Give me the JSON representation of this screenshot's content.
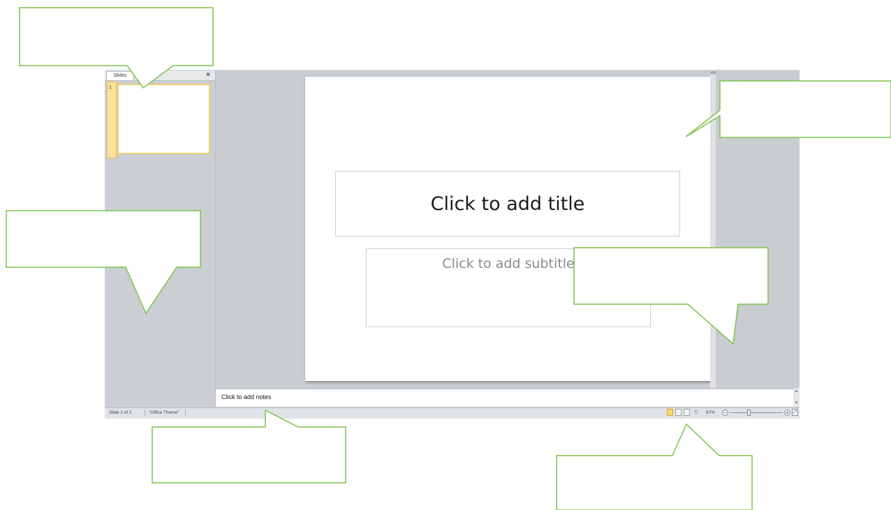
{
  "slides_pane": {
    "tabs": [
      "Slides",
      ""
    ],
    "close_glyph": "×",
    "thumbnail_number": "1"
  },
  "slide": {
    "title_placeholder": "Click to add title",
    "subtitle_placeholder": "Click to add subtitle"
  },
  "notes": {
    "placeholder": "Click to add notes",
    "scroll_up": "▲",
    "scroll_down": "▼"
  },
  "status_bar": {
    "slide_info": "Slide 1 of 1",
    "theme": "\"Office Theme\"",
    "zoom_level": "67%",
    "zoom_out": "−",
    "zoom_in": "+",
    "fit_glyph": "⤢",
    "slideshow_glyph": "▽"
  },
  "colors": {
    "callout_outline": "#7cc24a",
    "selection_accent": "#fbd476"
  },
  "callouts": [
    "",
    "",
    "",
    "",
    "",
    ""
  ]
}
